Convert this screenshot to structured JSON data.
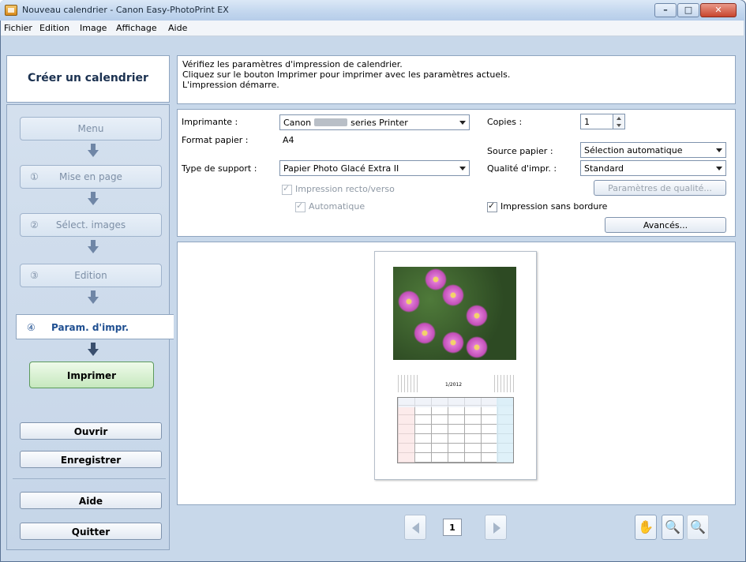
{
  "window": {
    "title": "Nouveau calendrier - Canon Easy-PhotoPrint EX"
  },
  "menu": {
    "items": [
      "Fichier",
      "Edition",
      "Image",
      "Affichage",
      "Aide"
    ]
  },
  "sidebar": {
    "header": "Créer un calendrier",
    "steps": [
      {
        "num": "",
        "label": "Menu"
      },
      {
        "num": "①",
        "label": "Mise en page"
      },
      {
        "num": "②",
        "label": "Sélect. images"
      },
      {
        "num": "③",
        "label": "Edition"
      }
    ],
    "active_step": {
      "num": "④",
      "label": "Param. d'impr."
    },
    "print_label": "Imprimer",
    "open_label": "Ouvrir",
    "save_label": "Enregistrer",
    "help_label": "Aide",
    "quit_label": "Quitter"
  },
  "info": {
    "lines": [
      "Vérifiez les paramètres d'impression de calendrier.",
      "Cliquez sur le bouton Imprimer pour imprimer avec les paramètres actuels.",
      "L'impression démarre."
    ]
  },
  "settings": {
    "printer_label": "Imprimante :",
    "printer_prefix": "Canon",
    "printer_suffix": "series Printer",
    "paper_size_label": "Format papier :",
    "paper_size_value": "A4",
    "media_type_label": "Type de support :",
    "media_type_value": "Papier Photo Glacé Extra II",
    "duplex_label": "Impression recto/verso",
    "auto_label": "Automatique",
    "copies_label": "Copies :",
    "copies_value": "1",
    "paper_source_label": "Source papier :",
    "paper_source_value": "Sélection automatique",
    "quality_label": "Qualité d'impr. :",
    "quality_value": "Standard",
    "quality_settings_label": "Paramètres de qualité...",
    "borderless_label": "Impression sans bordure",
    "advanced_label": "Avancés..."
  },
  "preview": {
    "month": "1/2012"
  },
  "pager": {
    "page": "1"
  }
}
